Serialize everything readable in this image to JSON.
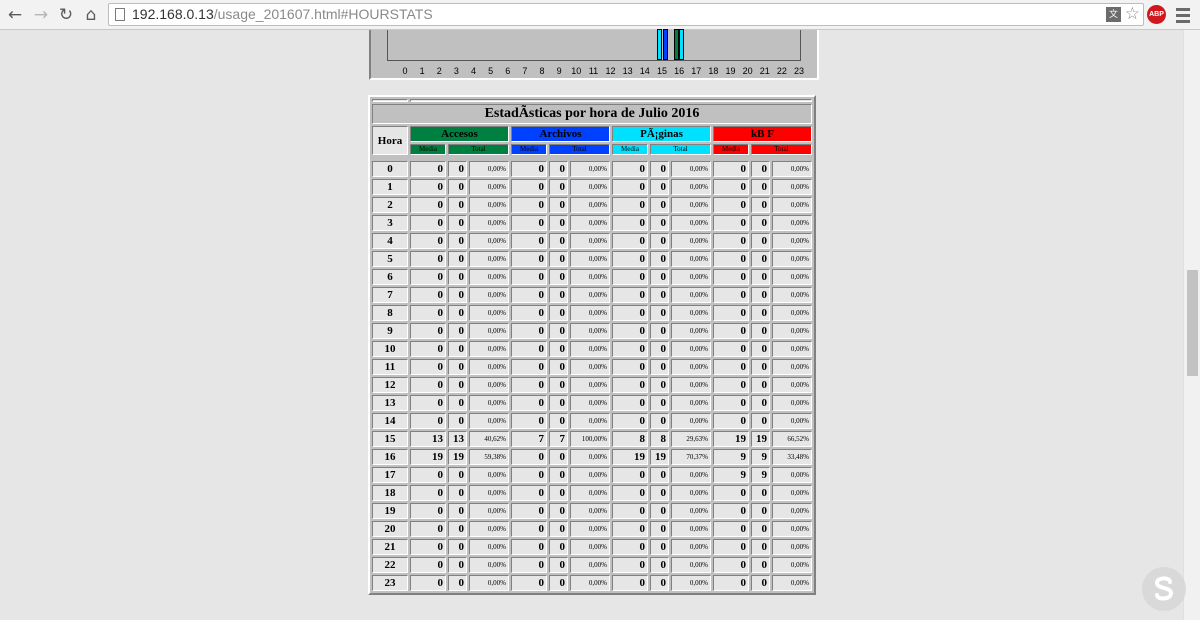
{
  "browser": {
    "url_host": "192.168.0.13",
    "url_path": "/usage_201607.html#HOURSTATS",
    "extension_label": "ABP"
  },
  "graph": {
    "hours": [
      "0",
      "1",
      "2",
      "3",
      "4",
      "5",
      "6",
      "7",
      "8",
      "9",
      "10",
      "11",
      "12",
      "13",
      "14",
      "15",
      "16",
      "17",
      "18",
      "19",
      "20",
      "21",
      "22",
      "23"
    ],
    "visible_bars": [
      {
        "hour": 15,
        "series": "paginas",
        "level": 1.0,
        "color": "#00e0ff"
      },
      {
        "hour": 15,
        "series": "archivos",
        "level": 1.0,
        "color": "#0040ff"
      },
      {
        "hour": 16,
        "series": "accesos",
        "level": 1.0,
        "color": "#008040"
      },
      {
        "hour": 16,
        "series": "paginas",
        "level": 1.0,
        "color": "#00e0ff"
      }
    ]
  },
  "table": {
    "title": "EstadÃsticas por hora de Julio 2016",
    "hour_header": "Hora",
    "groups": [
      {
        "label": "Accesos",
        "color": "#008040"
      },
      {
        "label": "Archivos",
        "color": "#0040ff"
      },
      {
        "label": "PÃ¡ginas",
        "color": "#00e0ff"
      },
      {
        "label": "kB F",
        "color": "#ff0000"
      }
    ],
    "sub_media": "Media",
    "sub_total": "Total",
    "rows": [
      [
        "0",
        "0",
        "0",
        "0,00%",
        "0",
        "0",
        "0,00%",
        "0",
        "0",
        "0,00%",
        "0",
        "0",
        "0,00%"
      ],
      [
        "1",
        "0",
        "0",
        "0,00%",
        "0",
        "0",
        "0,00%",
        "0",
        "0",
        "0,00%",
        "0",
        "0",
        "0,00%"
      ],
      [
        "2",
        "0",
        "0",
        "0,00%",
        "0",
        "0",
        "0,00%",
        "0",
        "0",
        "0,00%",
        "0",
        "0",
        "0,00%"
      ],
      [
        "3",
        "0",
        "0",
        "0,00%",
        "0",
        "0",
        "0,00%",
        "0",
        "0",
        "0,00%",
        "0",
        "0",
        "0,00%"
      ],
      [
        "4",
        "0",
        "0",
        "0,00%",
        "0",
        "0",
        "0,00%",
        "0",
        "0",
        "0,00%",
        "0",
        "0",
        "0,00%"
      ],
      [
        "5",
        "0",
        "0",
        "0,00%",
        "0",
        "0",
        "0,00%",
        "0",
        "0",
        "0,00%",
        "0",
        "0",
        "0,00%"
      ],
      [
        "6",
        "0",
        "0",
        "0,00%",
        "0",
        "0",
        "0,00%",
        "0",
        "0",
        "0,00%",
        "0",
        "0",
        "0,00%"
      ],
      [
        "7",
        "0",
        "0",
        "0,00%",
        "0",
        "0",
        "0,00%",
        "0",
        "0",
        "0,00%",
        "0",
        "0",
        "0,00%"
      ],
      [
        "8",
        "0",
        "0",
        "0,00%",
        "0",
        "0",
        "0,00%",
        "0",
        "0",
        "0,00%",
        "0",
        "0",
        "0,00%"
      ],
      [
        "9",
        "0",
        "0",
        "0,00%",
        "0",
        "0",
        "0,00%",
        "0",
        "0",
        "0,00%",
        "0",
        "0",
        "0,00%"
      ],
      [
        "10",
        "0",
        "0",
        "0,00%",
        "0",
        "0",
        "0,00%",
        "0",
        "0",
        "0,00%",
        "0",
        "0",
        "0,00%"
      ],
      [
        "11",
        "0",
        "0",
        "0,00%",
        "0",
        "0",
        "0,00%",
        "0",
        "0",
        "0,00%",
        "0",
        "0",
        "0,00%"
      ],
      [
        "12",
        "0",
        "0",
        "0,00%",
        "0",
        "0",
        "0,00%",
        "0",
        "0",
        "0,00%",
        "0",
        "0",
        "0,00%"
      ],
      [
        "13",
        "0",
        "0",
        "0,00%",
        "0",
        "0",
        "0,00%",
        "0",
        "0",
        "0,00%",
        "0",
        "0",
        "0,00%"
      ],
      [
        "14",
        "0",
        "0",
        "0,00%",
        "0",
        "0",
        "0,00%",
        "0",
        "0",
        "0,00%",
        "0",
        "0",
        "0,00%"
      ],
      [
        "15",
        "13",
        "13",
        "40,62%",
        "7",
        "7",
        "100,00%",
        "8",
        "8",
        "29,63%",
        "19",
        "19",
        "66,52%"
      ],
      [
        "16",
        "19",
        "19",
        "59,38%",
        "0",
        "0",
        "0,00%",
        "19",
        "19",
        "70,37%",
        "9",
        "9",
        "33,48%"
      ],
      [
        "17",
        "0",
        "0",
        "0,00%",
        "0",
        "0",
        "0,00%",
        "0",
        "0",
        "0,00%",
        "9",
        "9",
        "0,00%"
      ],
      [
        "18",
        "0",
        "0",
        "0,00%",
        "0",
        "0",
        "0,00%",
        "0",
        "0",
        "0,00%",
        "0",
        "0",
        "0,00%"
      ],
      [
        "19",
        "0",
        "0",
        "0,00%",
        "0",
        "0",
        "0,00%",
        "0",
        "0",
        "0,00%",
        "0",
        "0",
        "0,00%"
      ],
      [
        "20",
        "0",
        "0",
        "0,00%",
        "0",
        "0",
        "0,00%",
        "0",
        "0",
        "0,00%",
        "0",
        "0",
        "0,00%"
      ],
      [
        "21",
        "0",
        "0",
        "0,00%",
        "0",
        "0",
        "0,00%",
        "0",
        "0",
        "0,00%",
        "0",
        "0",
        "0,00%"
      ],
      [
        "22",
        "0",
        "0",
        "0,00%",
        "0",
        "0",
        "0,00%",
        "0",
        "0",
        "0,00%",
        "0",
        "0",
        "0,00%"
      ],
      [
        "23",
        "0",
        "0",
        "0,00%",
        "0",
        "0",
        "0,00%",
        "0",
        "0",
        "0,00%",
        "0",
        "0",
        "0,00%"
      ]
    ]
  }
}
